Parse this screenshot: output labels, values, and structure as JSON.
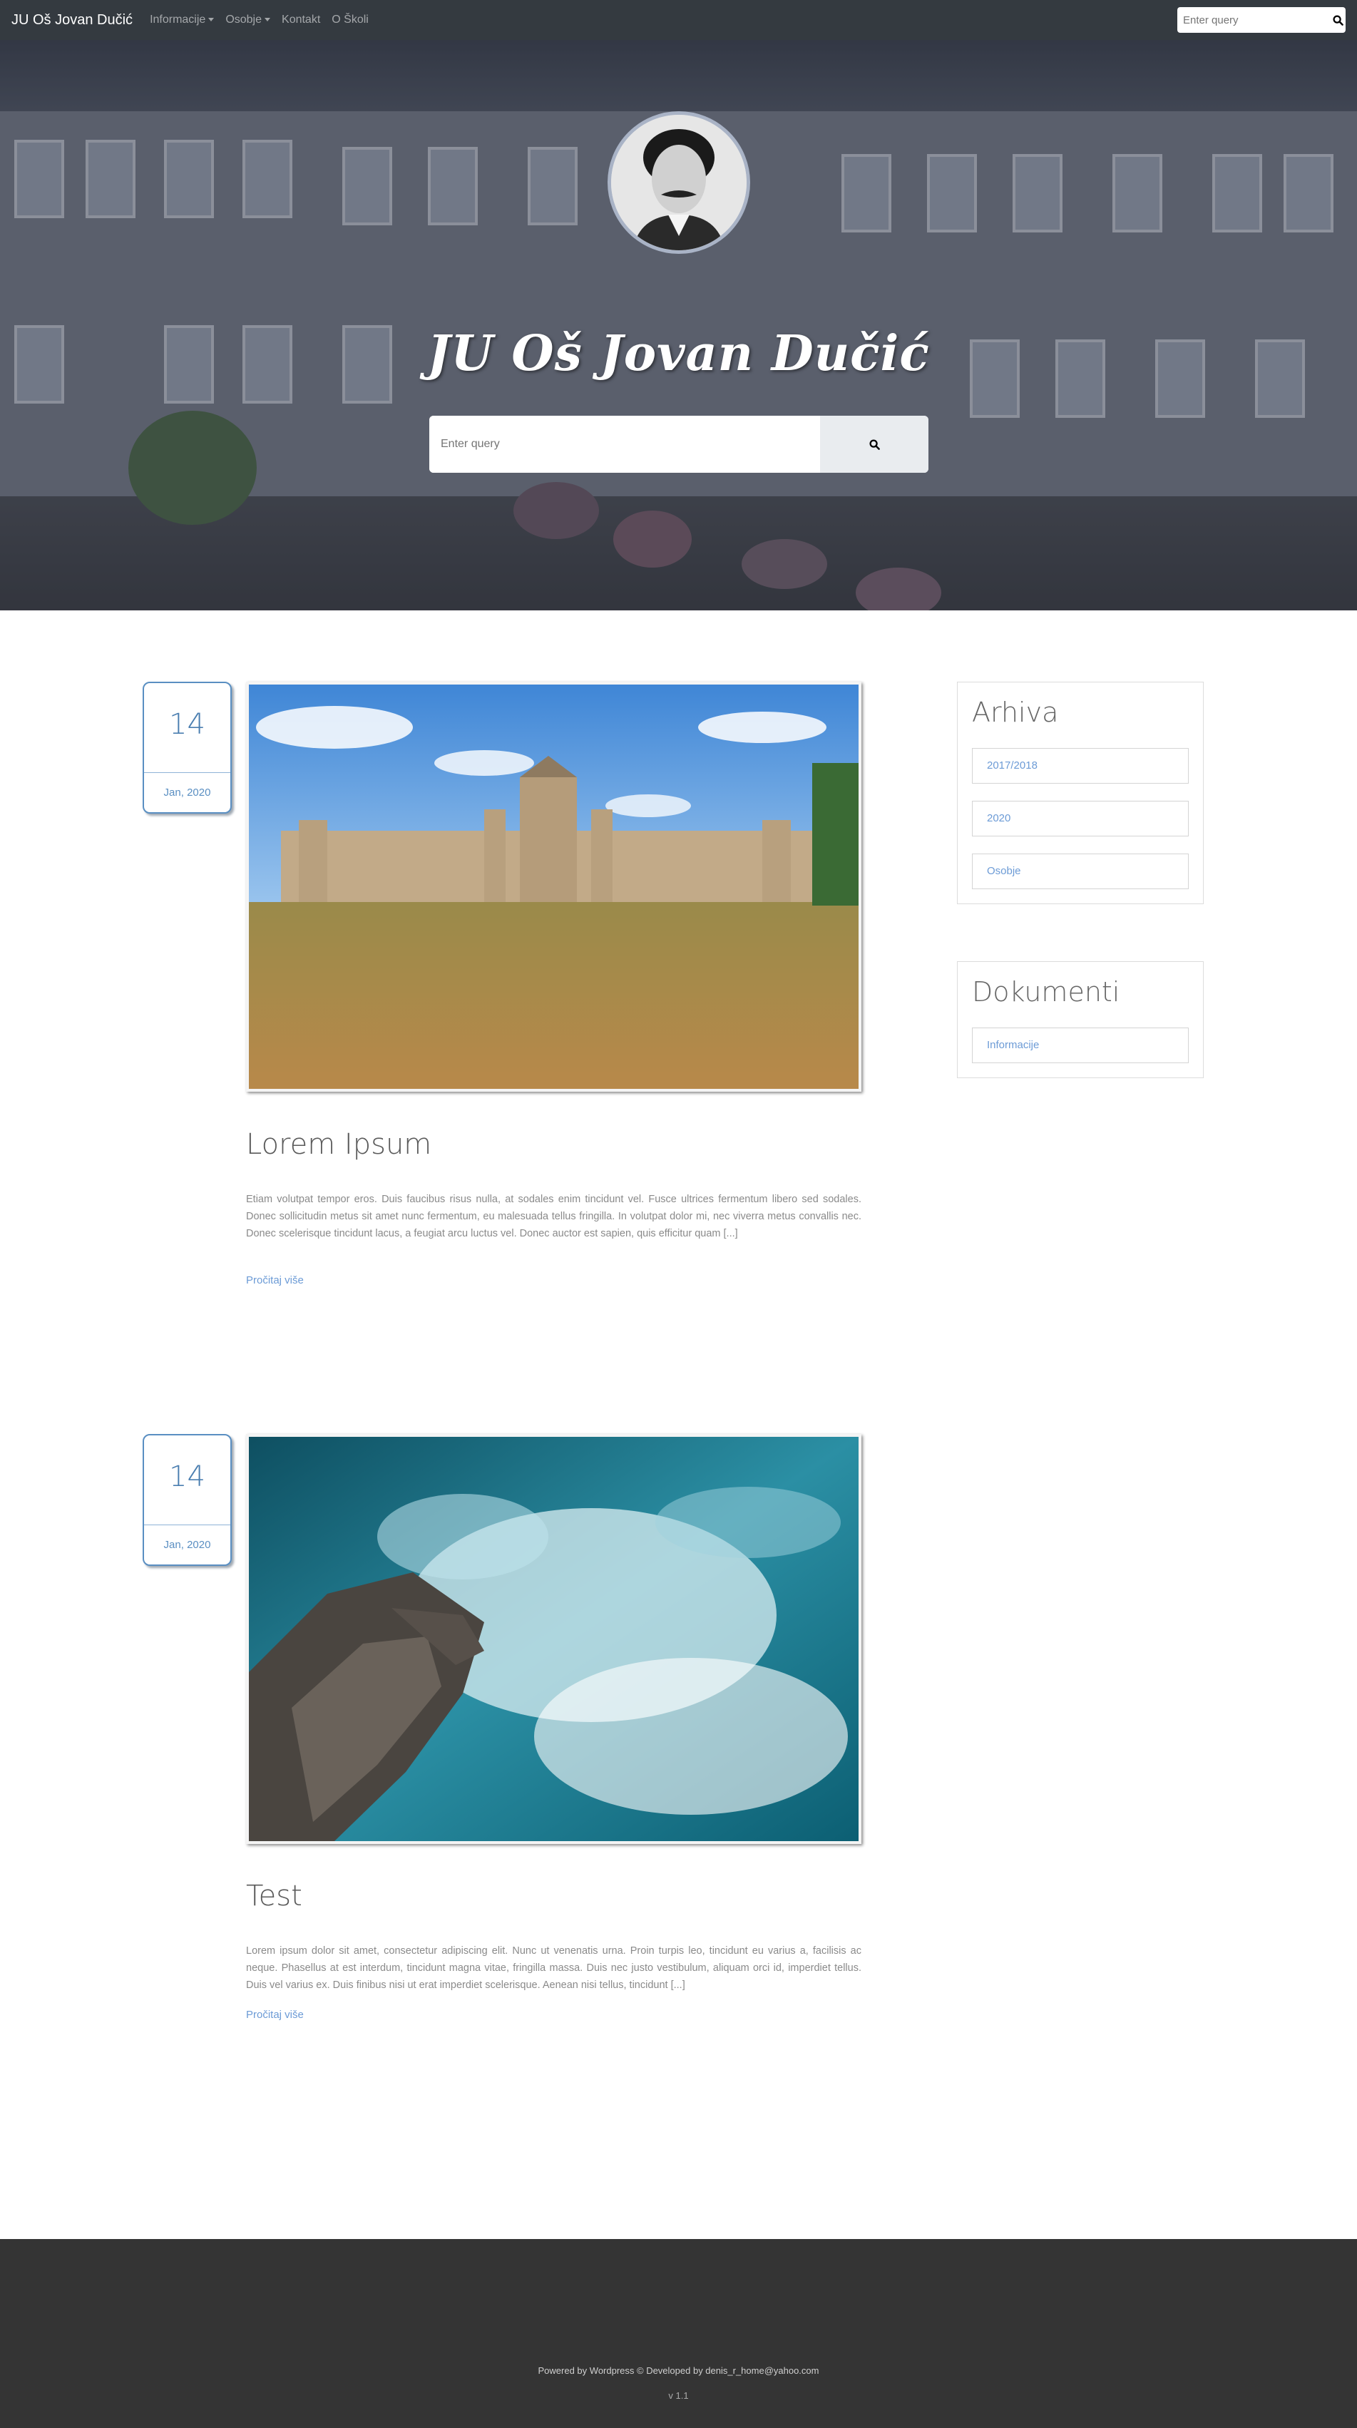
{
  "navbar": {
    "brand": "JU Oš Jovan Dučić",
    "items": [
      {
        "label": "Informacije",
        "dropdown": true
      },
      {
        "label": "Osobje",
        "dropdown": true
      },
      {
        "label": "Kontakt",
        "dropdown": false
      },
      {
        "label": "O Školi",
        "dropdown": false
      }
    ],
    "search_placeholder": "Enter query"
  },
  "hero": {
    "title": "JU Oš Jovan Dučić",
    "search_placeholder": "Enter query"
  },
  "posts": [
    {
      "day": "14",
      "month_year": "Jan, 2020",
      "title": "Lorem Ipsum",
      "excerpt": "Etiam volutpat tempor eros. Duis faucibus risus nulla, at sodales enim tincidunt vel. Fusce ultrices fermentum libero sed sodales. Donec sollicitudin metus sit amet nunc fermentum, eu malesuada tellus fringilla. In volutpat dolor mi, nec viverra metus convallis nec. Donec scelerisque tincidunt lacus, a feugiat arcu luctus vel. Donec auctor est sapien, quis efficitur quam [...]",
      "read_more": "Pročitaj više"
    },
    {
      "day": "14",
      "month_year": "Jan, 2020",
      "title": "Test",
      "excerpt": "Lorem ipsum dolor sit amet, consectetur adipiscing elit. Nunc ut venenatis urna. Proin turpis leo, tincidunt eu varius a, facilisis ac neque. Phasellus at est interdum, tincidunt magna vitae, fringilla massa. Duis nec justo vestibulum, aliquam orci id, imperdiet tellus. Duis vel varius ex. Duis finibus nisi ut erat imperdiet scelerisque. Aenean nisi tellus, tincidunt [...]",
      "read_more": "Pročitaj više"
    }
  ],
  "sidebar": {
    "archive": {
      "title": "Arhiva",
      "links": [
        "2017/2018",
        "2020",
        "Osobje"
      ]
    },
    "documents": {
      "title": "Dokumenti",
      "links": [
        "Informacije"
      ]
    }
  },
  "footer": {
    "credit": "Powered by Wordpress © Developed by denis_r_home@yahoo.com",
    "version": "v 1.1"
  },
  "colors": {
    "navbar_bg": "#343a40",
    "accent_blue": "#5a8fc2",
    "link_blue": "#6c9bd6",
    "footer_bg": "#343434"
  },
  "icons": {
    "search": "search-icon",
    "dropdown": "caret-down-icon"
  }
}
